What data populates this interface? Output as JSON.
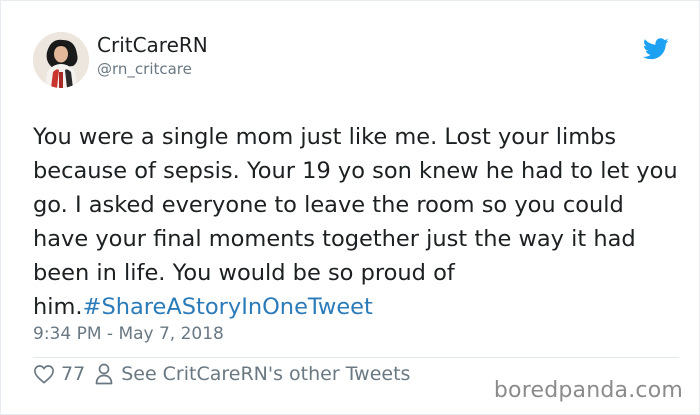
{
  "author": {
    "display_name": "CritCareRN",
    "handle": "@rn_critcare",
    "avatar_icon": "profile-photo"
  },
  "brand": {
    "icon": "twitter-bird-icon",
    "color": "#1da1f2"
  },
  "tweet": {
    "text": "You were a single mom just like me. Lost your limbs because of sepsis. Your 19 yo son knew he had to let you go. I asked everyone to leave the room so you could have your final moments together just the way it had been in life. You would be so proud of him.",
    "hashtag": "#ShareAStoryInOneTweet",
    "hashtag_color": "#2b7bb9",
    "timestamp": "9:34 PM - May 7, 2018"
  },
  "actions": {
    "like_icon": "heart-icon",
    "like_count": "77",
    "profile_icon": "person-icon",
    "profile_label": "See CritCareRN's other Tweets"
  },
  "watermark": "boredpanda.com"
}
